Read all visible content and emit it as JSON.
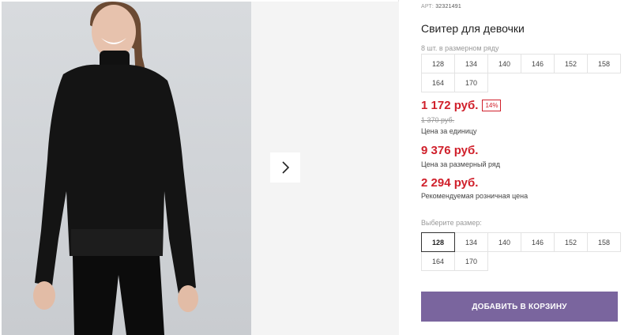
{
  "product": {
    "art_label": "АРТ:",
    "art_code": "32321491",
    "title": "Свитер для девочки",
    "pack_label": "8 шт. в размерном ряду",
    "pack_sizes": [
      "128",
      "134",
      "140",
      "146",
      "152",
      "158",
      "164",
      "170"
    ]
  },
  "pricing": {
    "unit_price": "1 172 руб.",
    "discount_badge": "14%",
    "old_price": "1 370 руб.",
    "unit_caption": "Цена за единицу",
    "pack_price": "9 376 руб.",
    "pack_caption": "Цена за размерный ряд",
    "retail_price": "2 294 руб.",
    "retail_caption": "Рекомендуемая розничная цена"
  },
  "size_select": {
    "label": "Выберите размер:",
    "options": [
      "128",
      "134",
      "140",
      "146",
      "152",
      "158",
      "164",
      "170"
    ],
    "selected": "128"
  },
  "actions": {
    "add_to_cart": "ДОБАВИТЬ В КОРЗИНУ"
  },
  "gallery": {
    "next_icon": "chevron-right-icon"
  },
  "colors": {
    "price_red": "#d0202b",
    "button_purple": "#7a659e"
  }
}
